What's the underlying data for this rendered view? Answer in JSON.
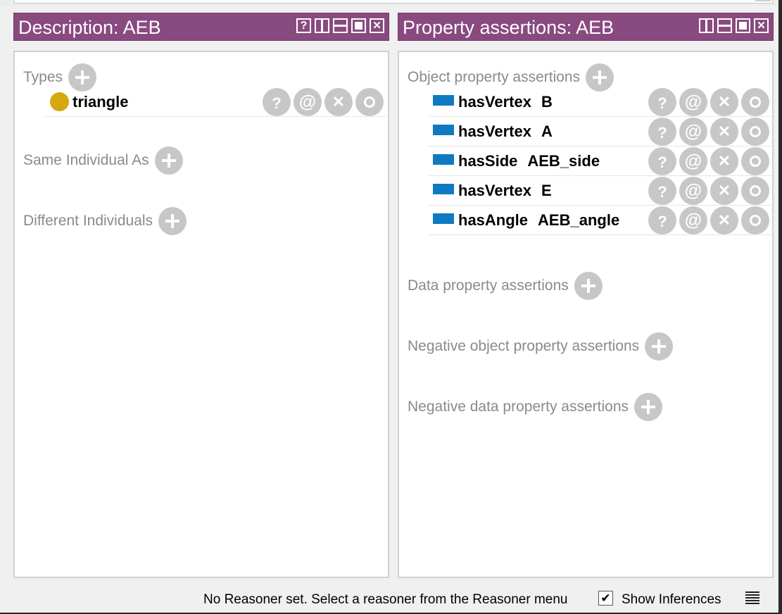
{
  "left_panel": {
    "title": "Description: AEB",
    "icons": [
      "help-icon",
      "split-vertical-icon",
      "split-horizontal-icon",
      "maximize-icon",
      "close-icon"
    ],
    "sections": {
      "types": {
        "title": "Types",
        "items": [
          {
            "label": "triangle",
            "icon": "class-dot-icon"
          }
        ]
      },
      "same_individual": {
        "title": "Same Individual As"
      },
      "different_individuals": {
        "title": "Different Individuals"
      }
    }
  },
  "right_panel": {
    "title": "Property assertions: AEB",
    "icons": [
      "split-vertical-icon",
      "split-horizontal-icon",
      "maximize-icon",
      "close-icon"
    ],
    "sections": {
      "object_props": {
        "title": "Object property assertions",
        "items": [
          {
            "property": "hasVertex",
            "value": "B"
          },
          {
            "property": "hasVertex",
            "value": "A"
          },
          {
            "property": "hasSide",
            "value": "AEB_side"
          },
          {
            "property": "hasVertex",
            "value": "E"
          },
          {
            "property": "hasAngle",
            "value": "AEB_angle"
          }
        ]
      },
      "data_props": {
        "title": "Data property assertions"
      },
      "neg_object_props": {
        "title": "Negative object property assertions"
      },
      "neg_data_props": {
        "title": "Negative data property assertions"
      }
    }
  },
  "row_actions": {
    "explain": "?",
    "annotate": "@",
    "delete": "✕",
    "edit": "o"
  },
  "status": {
    "message": "No Reasoner set. Select a reasoner from the Reasoner menu",
    "show_inferences_label": "Show Inferences",
    "show_inferences_checked": true,
    "checkbox_mark": "✔"
  },
  "colors": {
    "header": "#894a80",
    "class_dot": "#d4a80e",
    "object_property": "#0f79c1",
    "action_button": "#c7c7c7"
  }
}
